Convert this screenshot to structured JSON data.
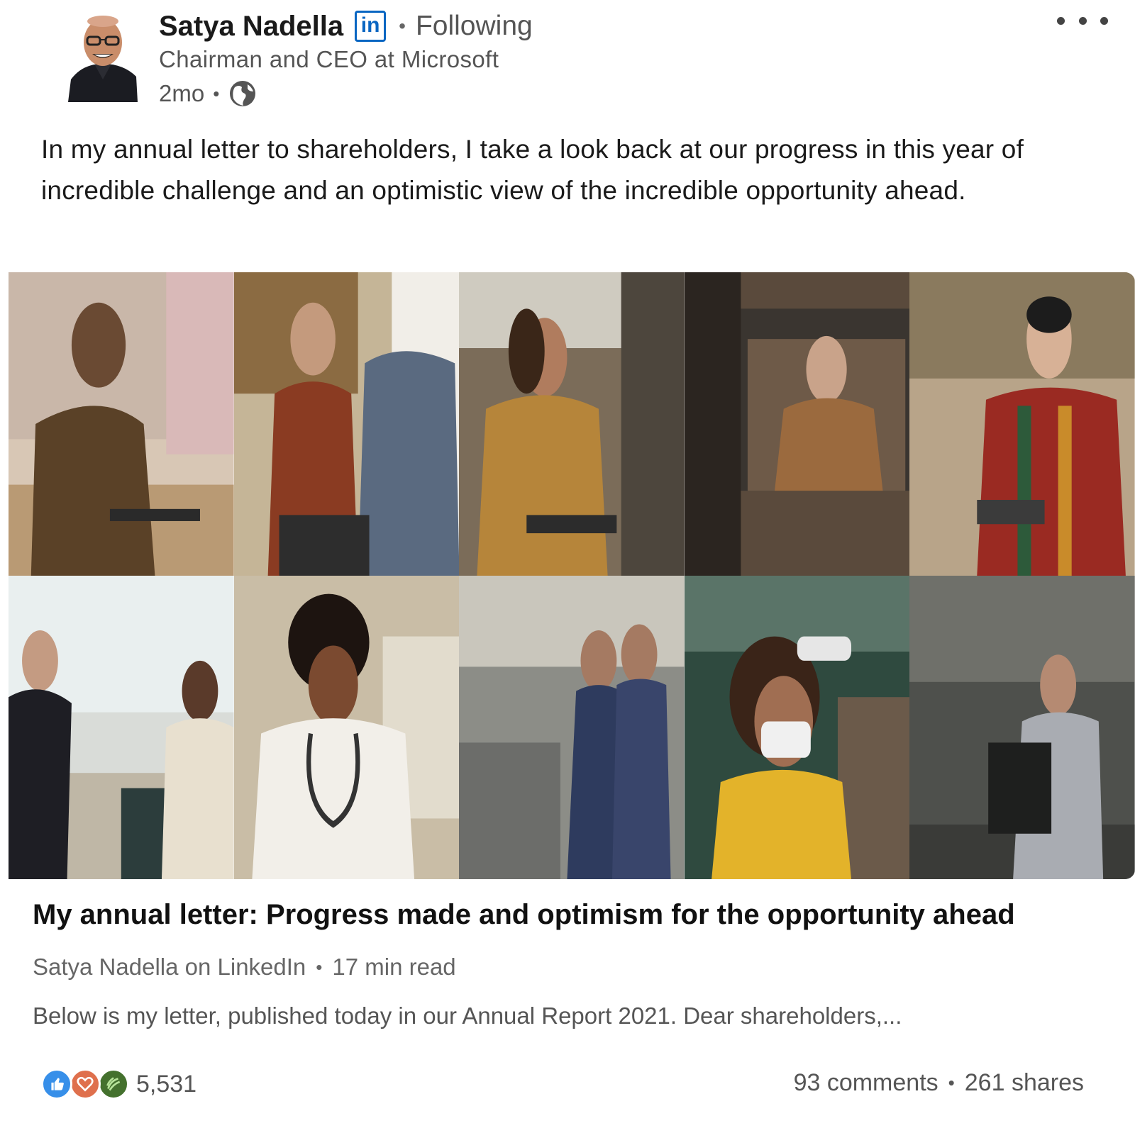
{
  "post": {
    "author": {
      "name": "Satya Nadella",
      "badge": "in",
      "follow_status": "Following",
      "headline": "Chairman and CEO at Microsoft",
      "time_ago": "2mo",
      "visibility_icon": "globe-icon"
    },
    "text": "In my annual letter to shareholders, I take a look back at our progress in this year of incredible challenge and an optimistic view of the incredible opportunity ahead."
  },
  "article": {
    "title": "My annual letter: Progress made and optimism for the opportunity ahead",
    "source": "Satya Nadella on LinkedIn",
    "read_time": "17 min read",
    "snippet": "Below is my letter, published today in our Annual Report 2021. Dear shareholders,..."
  },
  "social": {
    "reaction_icons": [
      "like-icon",
      "love-icon",
      "celebrate-icon"
    ],
    "reaction_count": "5,531",
    "comments": "93 comments",
    "shares": "261 shares"
  },
  "colors": {
    "linkedin_blue": "#0a66c2",
    "like": "#378fe9",
    "love": "#df704d",
    "celebrate": "#44712e"
  }
}
